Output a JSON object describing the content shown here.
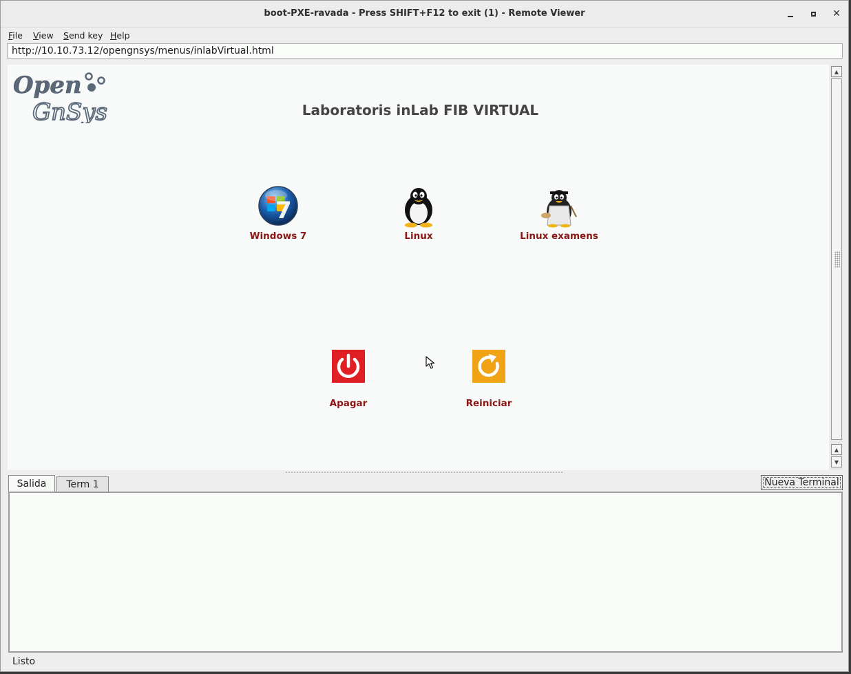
{
  "window": {
    "title": "boot-PXE-ravada - Press SHIFT+F12 to exit (1) - Remote Viewer",
    "controls": [
      "minimize-icon",
      "maximize-icon",
      "close-icon"
    ]
  },
  "menubar": {
    "items": [
      {
        "label": "File",
        "mnemonic": "F",
        "rest": "ile"
      },
      {
        "label": "View",
        "mnemonic": "V",
        "rest": "iew"
      },
      {
        "label": "Send key",
        "mnemonic": "S",
        "rest": "end key"
      },
      {
        "label": "Help",
        "mnemonic": "H",
        "rest": "elp"
      }
    ]
  },
  "url": "http://10.10.73.12/opengnsys/menus/inlabVirtual.html",
  "page": {
    "logo": {
      "line1": "Open",
      "line2": "GnSys"
    },
    "title": "Laboratoris inLab FIB VIRTUAL",
    "os_options": [
      {
        "label": "Windows 7",
        "icon": "windows7-logo-icon"
      },
      {
        "label": "Linux",
        "icon": "tux-penguin-icon"
      },
      {
        "label": "Linux examens",
        "icon": "tux-professor-icon"
      }
    ],
    "power_options": [
      {
        "label": "Apagar",
        "icon": "power-off-icon",
        "color": "#e01f25"
      },
      {
        "label": "Reiniciar",
        "icon": "restart-icon",
        "color": "#f0a315"
      }
    ],
    "label_color": "#8c1515"
  },
  "console": {
    "tabs": [
      "Salida",
      "Term 1"
    ],
    "active_tab": "Salida",
    "new_terminal_button": "Nueva Terminal",
    "output": ""
  },
  "statusbar": {
    "text": "Listo"
  }
}
